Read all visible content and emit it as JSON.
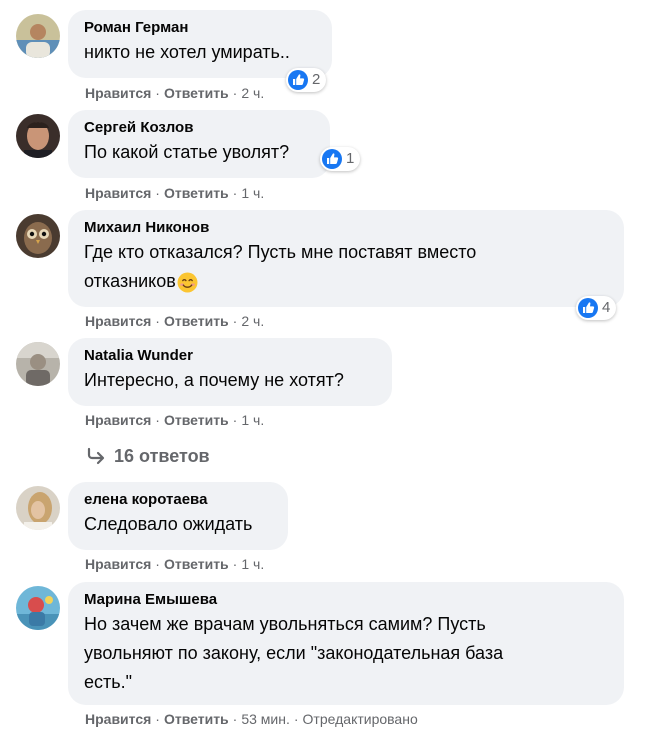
{
  "common": {
    "like": "Нравится",
    "reply": "Ответить",
    "dot": "·"
  },
  "comments": [
    {
      "author": "Роман Герман",
      "text": "никто не хотел умирать..",
      "reactions": "2",
      "time": "2 ч."
    },
    {
      "author": "Сергей Козлов",
      "text": "По какой статье уволят?",
      "reactions": "1",
      "time": "1 ч."
    },
    {
      "author": "Михаил Никонов",
      "text_line1": "Где кто отказался? Пусть мне поставят вместо",
      "text_line2": "отказников",
      "emoji": "smiling-face-emoji",
      "reactions": "4",
      "time": "2 ч."
    },
    {
      "author": "Natalia Wunder",
      "text": "Интересно, а почему не хотят?",
      "time": "1 ч."
    },
    {
      "author": "елена коротаева",
      "text": "Следовало ожидать",
      "time": "1 ч."
    },
    {
      "author": "Марина Емышева",
      "text_line1": "Но зачем же врачам увольняться самим? Пусть",
      "text_line2": "увольняют по закону, если \"законодательная база",
      "text_line3": "есть.\"",
      "time": "53 мин.",
      "edited": "Отредактировано"
    }
  ],
  "replies_link": "16 ответов",
  "colors": {
    "bubble": "#f0f2f5",
    "meta_text": "#65676b",
    "like_blue": "#1877f2"
  }
}
